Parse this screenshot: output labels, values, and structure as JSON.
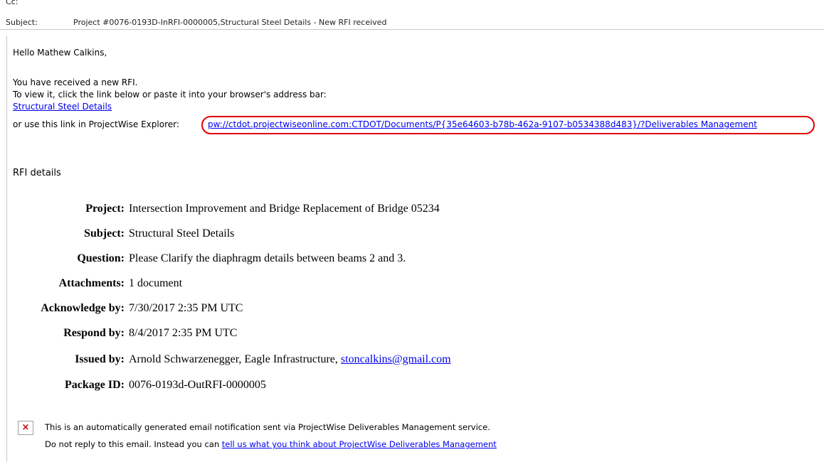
{
  "header": {
    "cc_label": "Cc:",
    "cc_value": "",
    "subject_label": "Subject:",
    "subject_value": "Project #0076-0193D-InRFI-0000005,Structural Steel Details - New RFI received"
  },
  "body": {
    "greeting": "Hello Mathew Calkins,",
    "line1": "You have received a new RFI.",
    "line2": "To view it, click the link below or paste it into your browser's address bar:",
    "rfi_link": "Structural Steel Details",
    "explorer_prefix": "or use this link in ProjectWise Explorer:",
    "explorer_link": "pw://ctdot.projectwiseonline.com:CTDOT/Documents/P{35e64603-b78b-462a-9107-b0534388d483}/?Deliverables Management",
    "rfi_details_title": "RFI details"
  },
  "details": [
    {
      "label": "Project",
      "value": "Intersection Improvement and Bridge Replacement of Bridge 05234"
    },
    {
      "label": "Subject",
      "value": "Structural Steel Details"
    },
    {
      "label": "Question",
      "value": "Please Clarify the diaphragm details between beams 2 and 3."
    },
    {
      "label": "Attachments",
      "value": "1 document"
    },
    {
      "label": "Acknowledge by",
      "value": "7/30/2017 2:35 PM UTC"
    },
    {
      "label": "Respond by",
      "value": "8/4/2017 2:35 PM UTC"
    },
    {
      "label": "Issued by",
      "value": "Arnold Schwarzenegger, Eagle Infrastructure, ",
      "email": "stoncalkins@gmail.com"
    },
    {
      "label": "Package ID",
      "value": "0076-0193d-OutRFI-0000005"
    }
  ],
  "label_suffix": ":",
  "footer": {
    "broken_image_icon": "broken-image-icon",
    "line1": "This is an automatically generated email notification sent via ProjectWise Deliverables Management service.",
    "line2_prefix": "Do not reply to this email. Instead you can ",
    "feedback_link": "tell us what you think about ProjectWise Deliverables Management"
  },
  "colors": {
    "link": "#0000ee",
    "highlight_ring": "#e00000"
  }
}
